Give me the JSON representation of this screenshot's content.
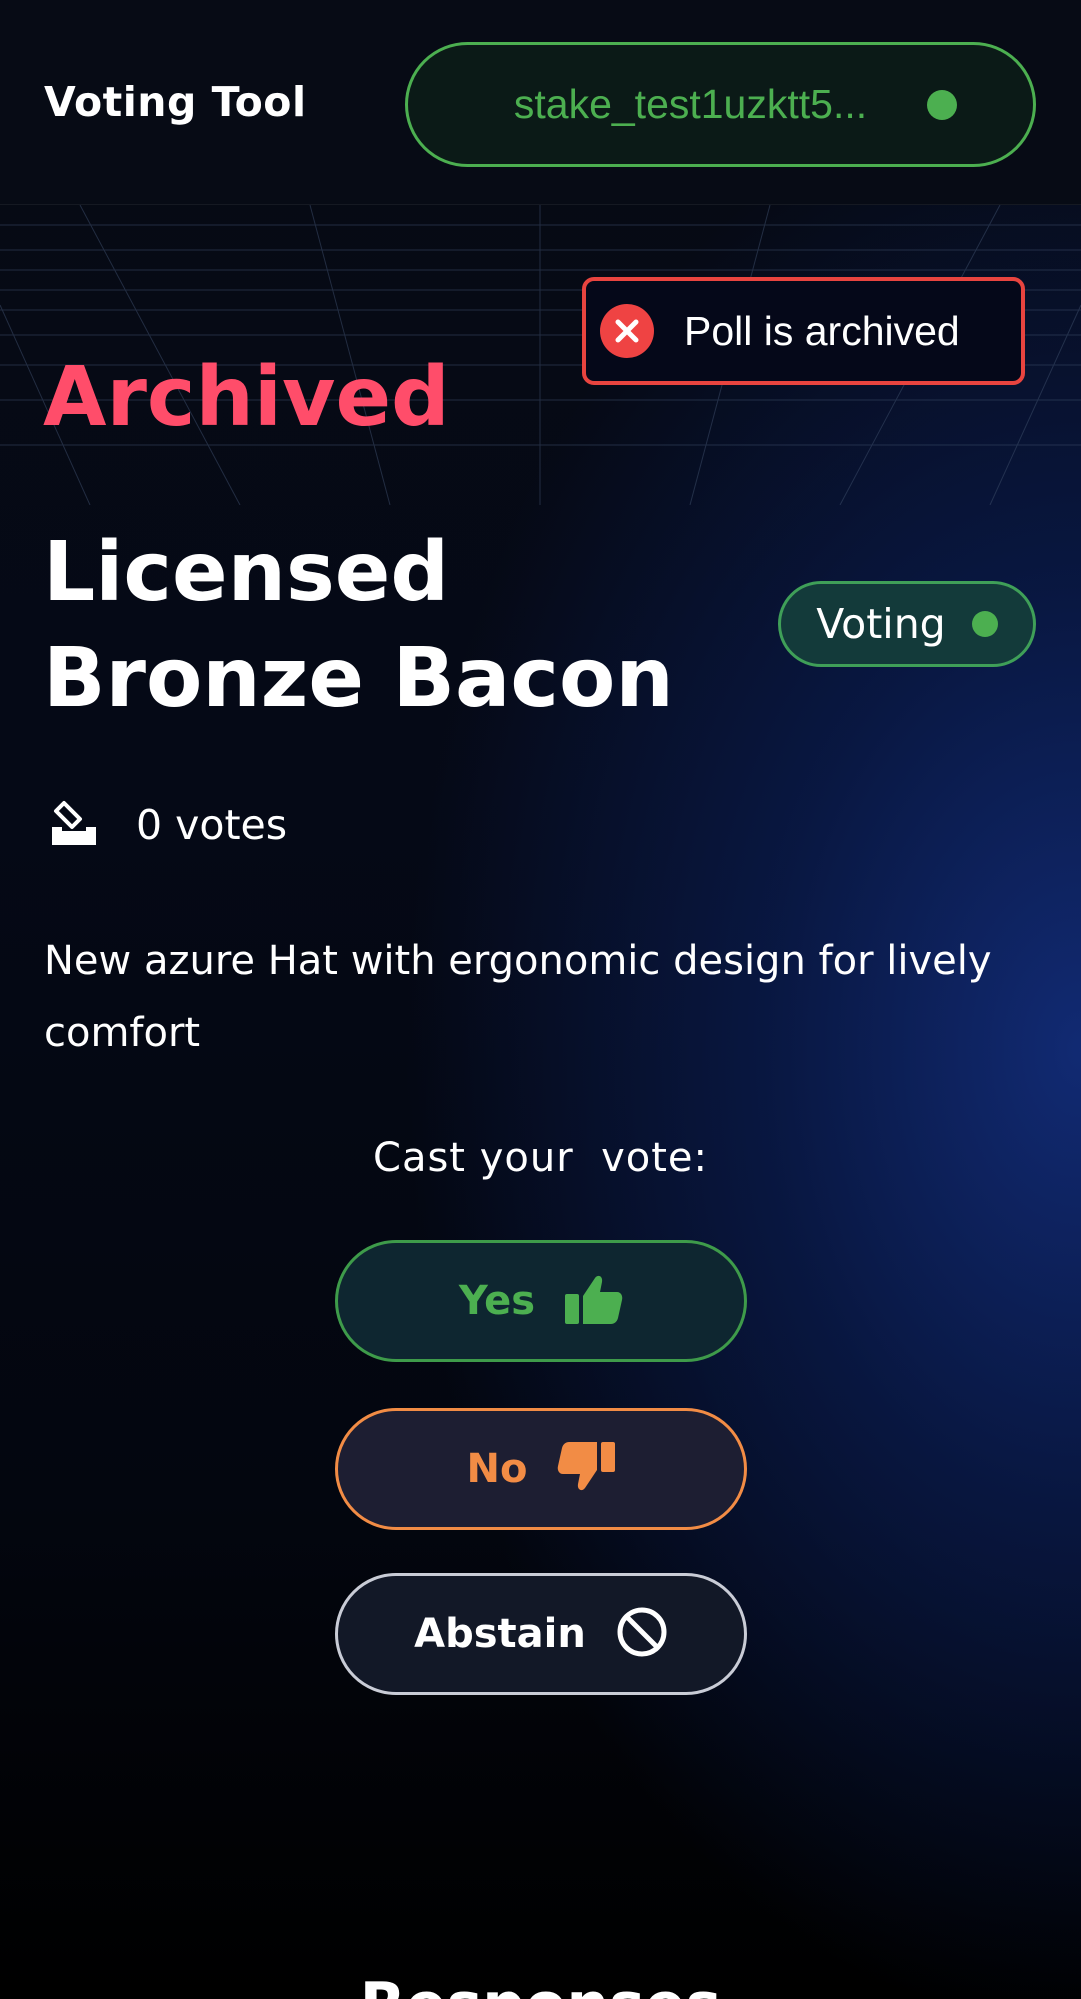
{
  "header": {
    "brand": "Voting Tool",
    "wallet_address": "stake_test1uzktt5...",
    "wallet_status_color": "#4caf50"
  },
  "toast": {
    "message": "Poll is archived",
    "icon": "close-circle-icon",
    "accent": "#e8443f"
  },
  "poll": {
    "status_label": "Archived",
    "title": "Licensed Bronze Bacon",
    "badge": "Voting",
    "votes": "0 votes",
    "votes_icon": "ballot-box-icon",
    "description": "New azure Hat with ergonomic design for lively comfort"
  },
  "vote": {
    "prompt": "Cast your  vote:",
    "yes_label": "Yes",
    "no_label": "No",
    "abstain_label": "Abstain",
    "yes_icon": "thumbs-up-icon",
    "no_icon": "thumbs-down-icon",
    "abstain_icon": "ban-icon"
  },
  "colors": {
    "yes": "#4caf50",
    "no": "#f28c45",
    "archived": "#ff4d6a"
  },
  "footer": {
    "partial_heading": "Responses"
  }
}
